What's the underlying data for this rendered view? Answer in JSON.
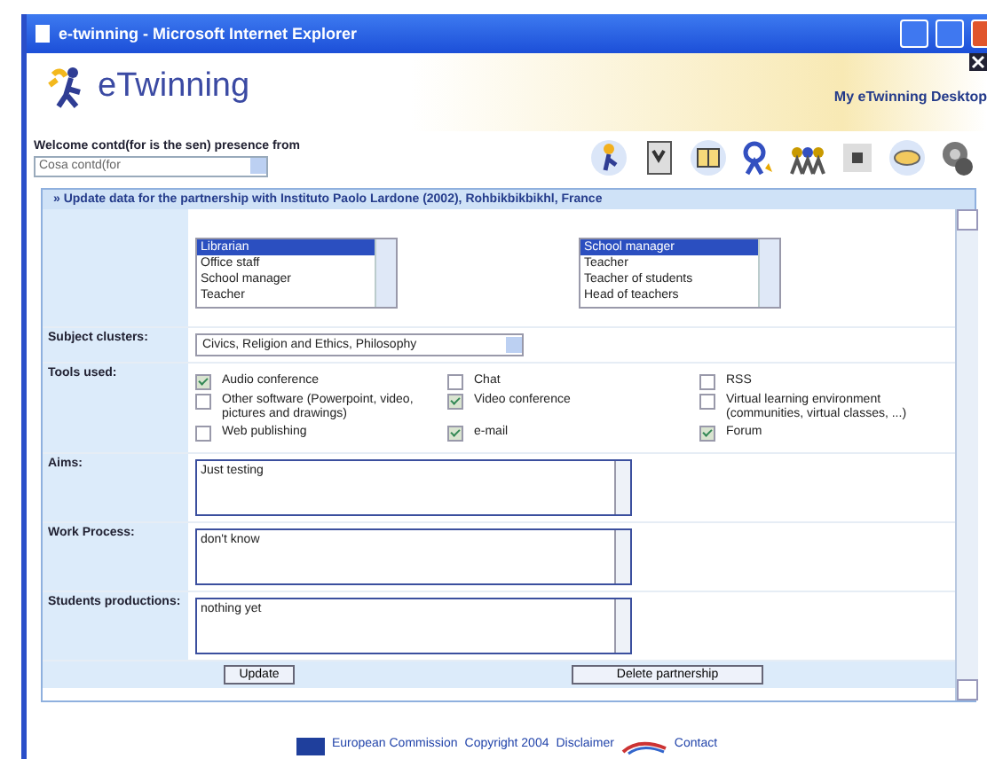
{
  "window": {
    "title": "e-twinning - Microsoft Internet Explorer"
  },
  "header": {
    "logo": "eTwinning",
    "desktop_link": "My eTwinning Desktop",
    "welcome": "Welcome contd(for is the sen) presence from",
    "profile_select": "Cosa contd(for"
  },
  "panel": {
    "title": "» Update data for the partnership with Instituto Paolo Lardone (2002), Rohbikbikbikhl, France",
    "role_lists": [
      {
        "items": [
          {
            "label": "Librarian",
            "selected": true
          },
          {
            "label": "Office staff",
            "selected": false
          },
          {
            "label": "School manager",
            "selected": false
          },
          {
            "label": "Teacher",
            "selected": false
          }
        ]
      },
      {
        "items": [
          {
            "label": "School manager",
            "selected": true
          },
          {
            "label": "Teacher",
            "selected": false
          },
          {
            "label": "Teacher of students",
            "selected": false
          },
          {
            "label": "Head of teachers",
            "selected": false
          }
        ]
      }
    ],
    "subject_label": "Subject clusters:",
    "subject_value": "Civics, Religion and Ethics, Philosophy",
    "tools_label": "Tools used:",
    "tools": [
      {
        "label": "Audio conference",
        "checked": true
      },
      {
        "label": "Chat",
        "checked": false
      },
      {
        "label": "RSS",
        "checked": false
      },
      {
        "label": "Other software (Powerpoint, video, pictures and drawings)",
        "checked": false
      },
      {
        "label": "Video conference",
        "checked": true
      },
      {
        "label": "Virtual learning environment (communities, virtual classes, ...)",
        "checked": false
      },
      {
        "label": "Web publishing",
        "checked": false
      },
      {
        "label": "e-mail",
        "checked": true
      },
      {
        "label": "Forum",
        "checked": true
      }
    ],
    "text_fields": [
      {
        "label": "Aims:",
        "value": "Just testing"
      },
      {
        "label": "Work Process:",
        "value": "don't know"
      },
      {
        "label": "Students productions:",
        "value": "nothing yet"
      }
    ],
    "buttons": [
      "Update",
      "Delete partnership"
    ]
  },
  "footer": {
    "links": [
      "European Commission",
      "Copyright 2004",
      "Disclaimer",
      "Contact"
    ]
  }
}
